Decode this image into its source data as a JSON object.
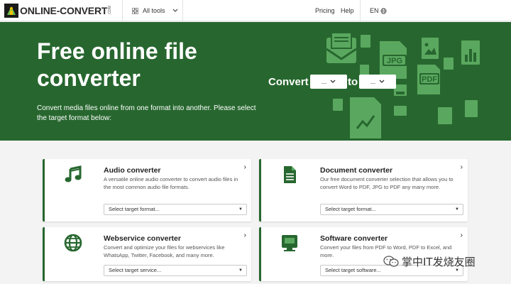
{
  "header": {
    "logo_text": "ONLINE-CONVERT",
    "logo_com": ".COM",
    "all_tools": "All tools",
    "pricing": "Pricing",
    "help": "Help",
    "language": "EN"
  },
  "hero": {
    "title": "Free online file converter",
    "description": "Convert media files online from one format into another. Please select the target format below:",
    "convert_word": "Convert",
    "to_word": "to",
    "from_select": "...",
    "to_select": "...",
    "deco_labels": [
      "JPG",
      "PDF"
    ]
  },
  "cards": [
    {
      "title": "Audio converter",
      "description": "A versatile online audio converter to convert audio files in the most common audio file formats.",
      "select_placeholder": "Select target format...",
      "icon": "music-note-icon"
    },
    {
      "title": "Document converter",
      "description": "Our free document converter selection that allows you to convert Word to PDF, JPG to PDF any many more.",
      "select_placeholder": "Select target format...",
      "icon": "document-icon"
    },
    {
      "title": "Webservice converter",
      "description": "Convert and optimize your files for webservices like WhatsApp, Twitter, Facebook, and many more.",
      "select_placeholder": "Select target service...",
      "icon": "globe-icon"
    },
    {
      "title": "Software converter",
      "description": "Convert your files from PDF to Word, PDF to Excel, and more.",
      "select_placeholder": "Select target software...",
      "icon": "monitor-icon"
    }
  ],
  "watermark": "掌中IT发烧友圈",
  "colors": {
    "brand_green": "#27672f",
    "deco_green": "#5aa85f",
    "background": "#f3f3f3"
  }
}
